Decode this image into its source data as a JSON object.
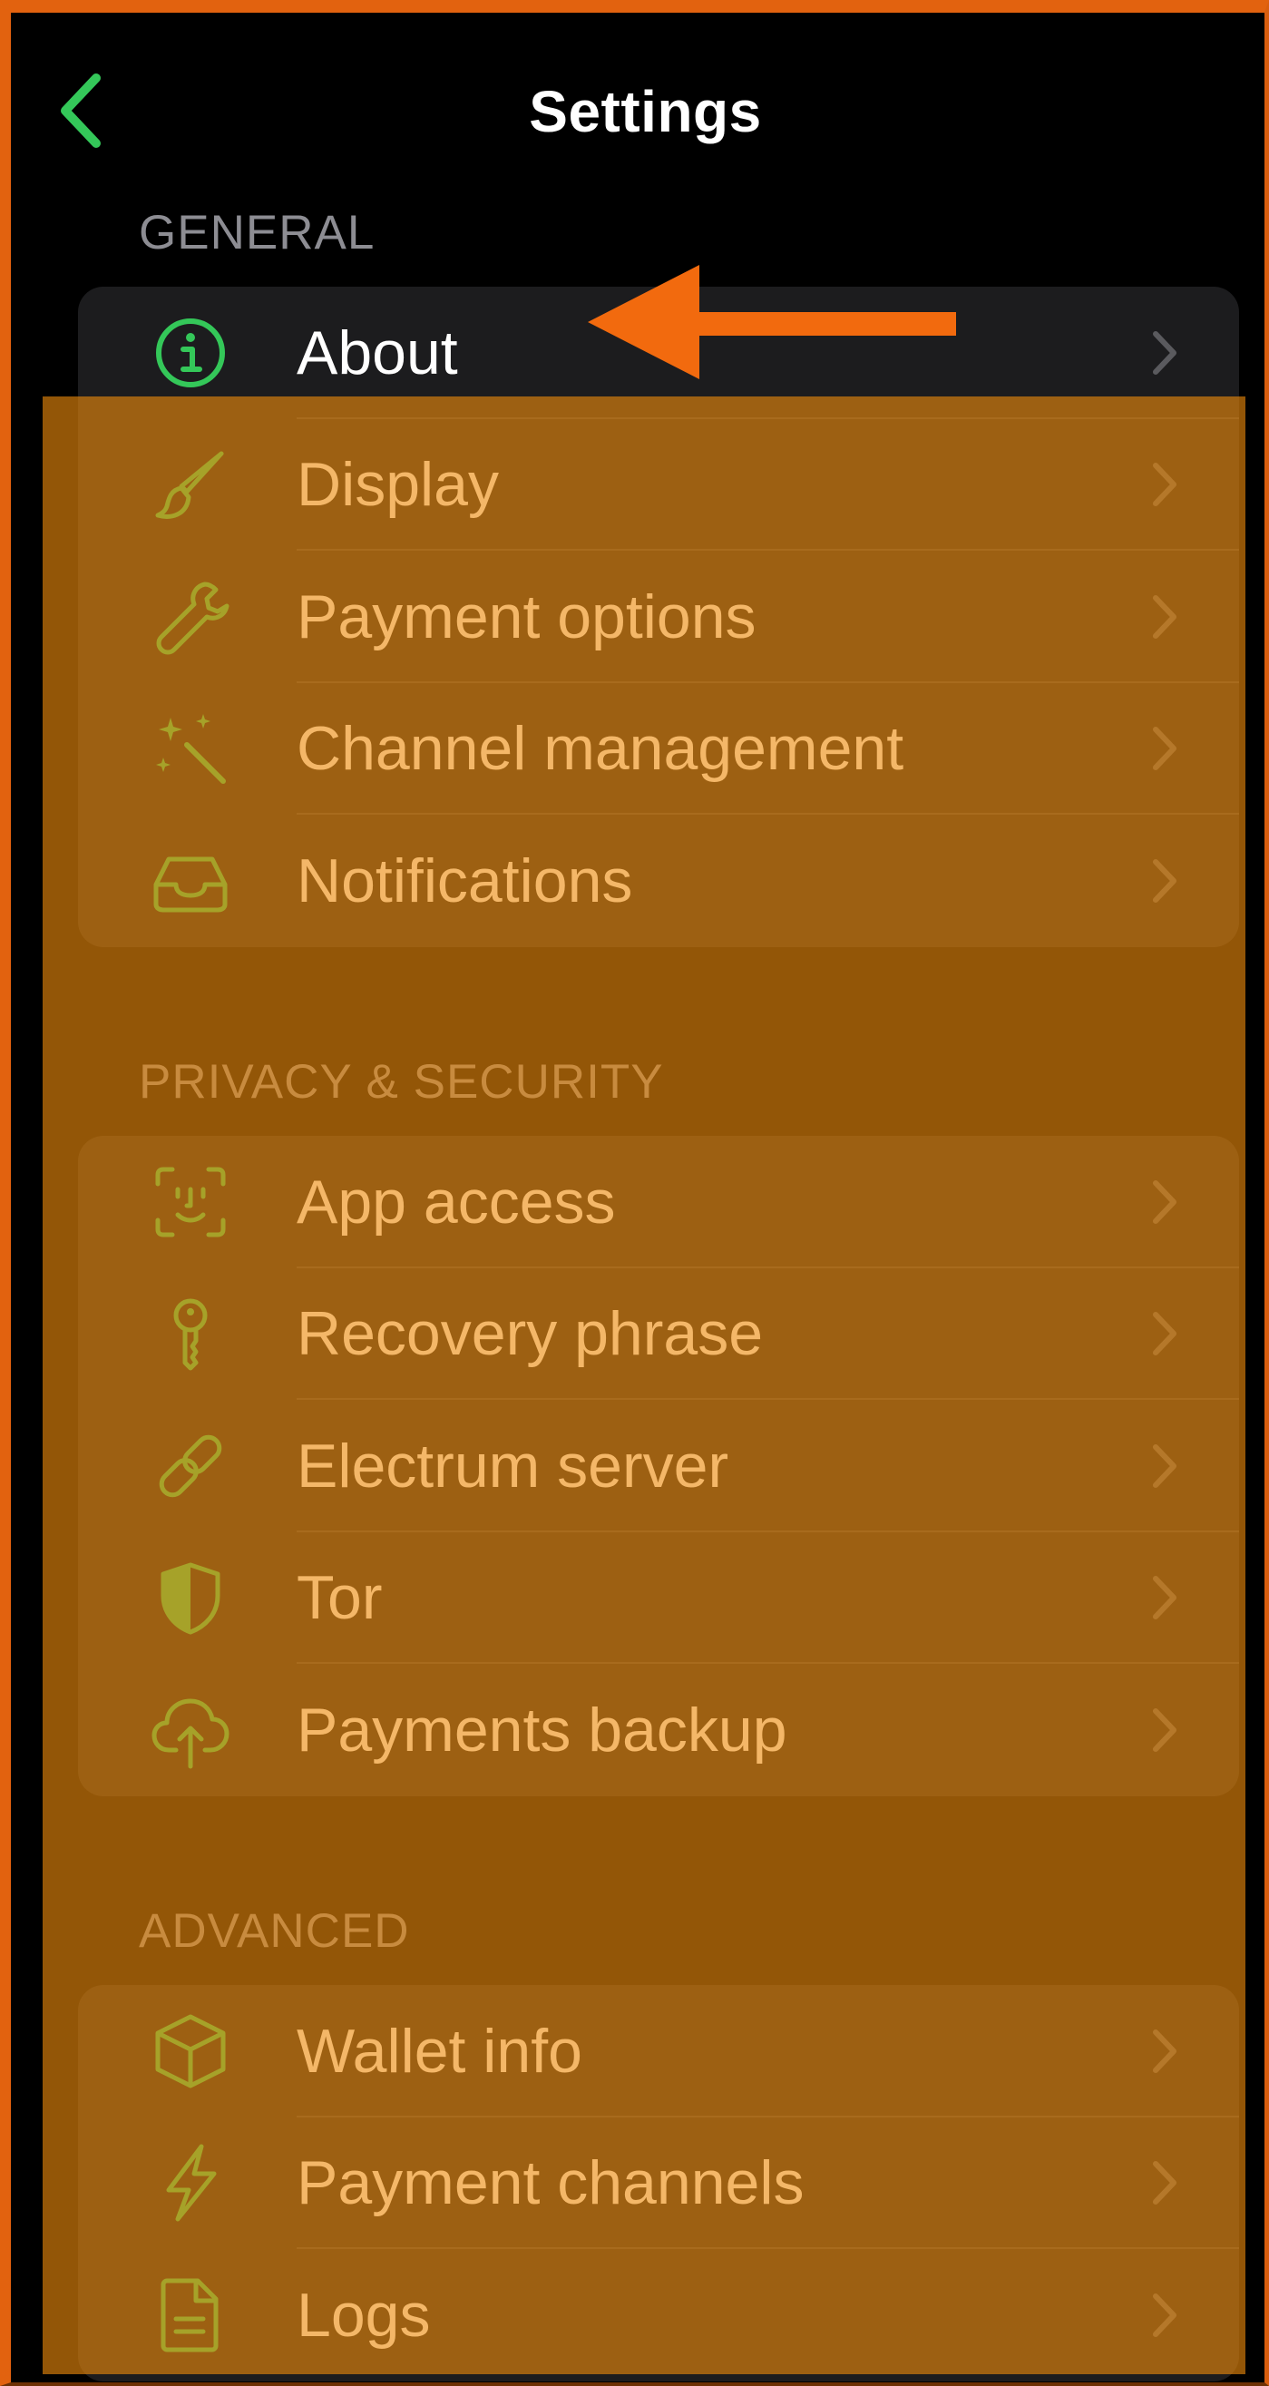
{
  "header": {
    "title": "Settings",
    "back_icon": "chevron-left-icon",
    "back_color": "#34c759"
  },
  "colors": {
    "accent_green": "#34c759",
    "overlay_orange": "#ee8a0c",
    "arrow_orange": "#f26a0e",
    "group_background": "#1c1c1e",
    "section_header": "#8d8d93"
  },
  "sections": [
    {
      "title": "GENERAL",
      "items": [
        {
          "label": "About",
          "icon": "info-circle-icon"
        },
        {
          "label": "Display",
          "icon": "paintbrush-icon"
        },
        {
          "label": "Payment options",
          "icon": "wrench-icon"
        },
        {
          "label": "Channel management",
          "icon": "magic-wand-icon"
        },
        {
          "label": "Notifications",
          "icon": "tray-inbox-icon"
        }
      ]
    },
    {
      "title": "PRIVACY & SECURITY",
      "items": [
        {
          "label": "App access",
          "icon": "face-id-icon"
        },
        {
          "label": "Recovery phrase",
          "icon": "key-icon"
        },
        {
          "label": "Electrum server",
          "icon": "link-icon"
        },
        {
          "label": "Tor",
          "icon": "shield-half-icon"
        },
        {
          "label": "Payments backup",
          "icon": "cloud-upload-icon"
        }
      ]
    },
    {
      "title": "ADVANCED",
      "items": [
        {
          "label": "Wallet info",
          "icon": "cube-icon"
        },
        {
          "label": "Payment channels",
          "icon": "bolt-icon"
        },
        {
          "label": "Logs",
          "icon": "document-icon"
        }
      ]
    }
  ],
  "annotation": {
    "arrow_icon": "arrow-left-icon",
    "points_to": "About"
  }
}
